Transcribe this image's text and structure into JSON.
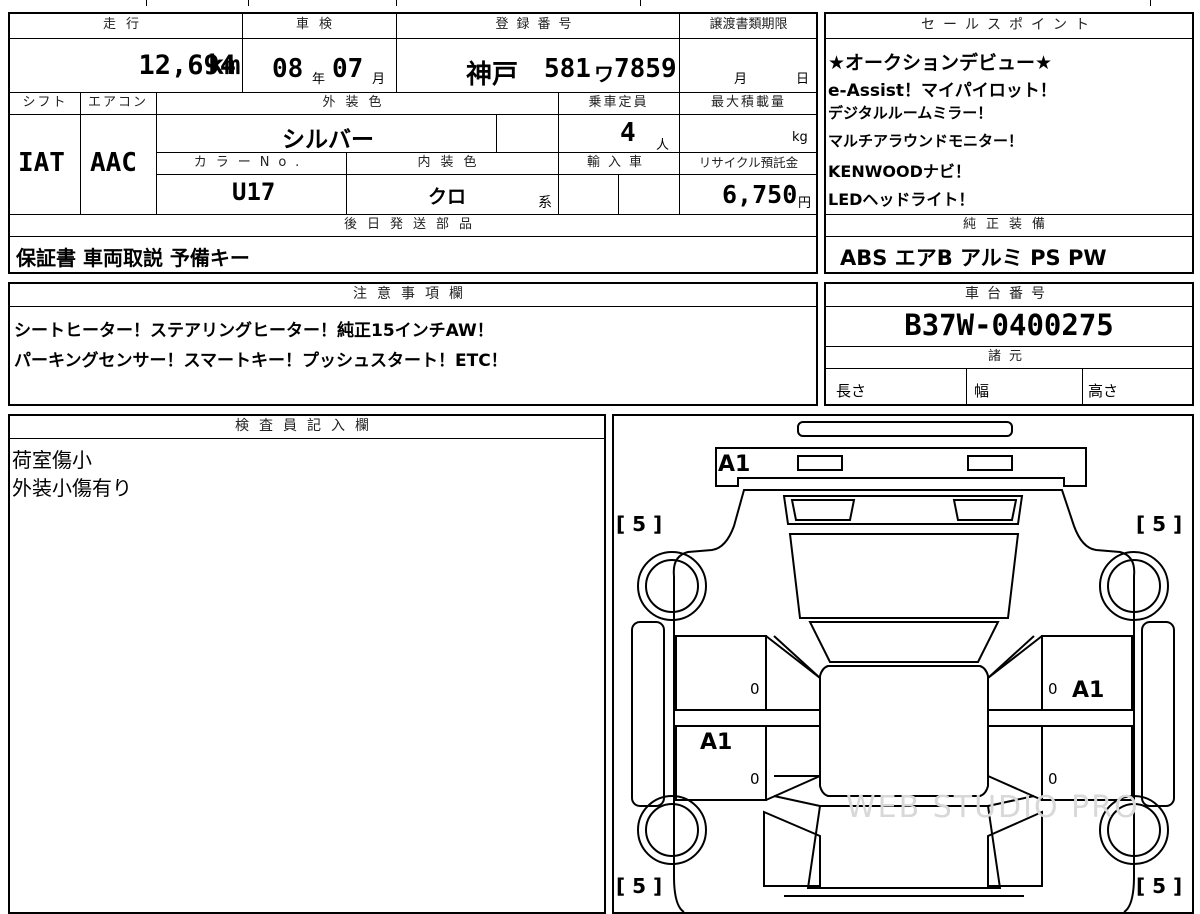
{
  "headers": {
    "mileage": "走行",
    "inspection": "車検",
    "registration": "登録番号",
    "transfer_deadline": "譲渡書類期限",
    "sales_points": "セールスポイント",
    "shift": "シフト",
    "aircon": "エアコン",
    "exterior_color": "外装色",
    "capacity": "乗車定員",
    "max_load": "最大積載量",
    "color_no": "カラーNo.",
    "interior_color": "内装色",
    "import": "輸入車",
    "recycle_fee": "リサイクル預託金",
    "later_parts": "後日発送部品",
    "genuine_equipment": "純正装備",
    "notes": "注意事項欄",
    "chassis_no": "車台番号",
    "specs": "諸元",
    "inspector": "検査員記入欄"
  },
  "vehicle": {
    "mileage_value": "12,694",
    "mileage_unit": "km",
    "inspection_year": "08",
    "year_label": "年",
    "inspection_month": "07",
    "month_label": "月",
    "registration_area": "神戸",
    "registration_class": "581",
    "registration_kana": "ワ",
    "registration_number": "7859",
    "transfer_month_label": "月",
    "transfer_day_label": "日",
    "shift_value": "IAT",
    "aircon_value": "AAC",
    "exterior_color_value": "シルバー",
    "capacity_value": "4",
    "capacity_unit": "人",
    "max_load_unit": "kg",
    "color_no_value": "U17",
    "interior_color_value": "クロ",
    "interior_color_suffix": "系",
    "recycle_value": "6,750",
    "recycle_unit": "円"
  },
  "sales_points": [
    "★オークションデビュー★",
    "e-Assist！マイパイロット！",
    "デジタルルームミラー！",
    "マルチアラウンドモニター！",
    "KENWOODナビ！",
    "LEDヘッドライト！"
  ],
  "later_parts_value": "保証書 車両取説 予備キー",
  "genuine_equipment_value": "ABS エアB アルミ PS PW",
  "notes_lines": [
    "シートヒーター！ステアリングヒーター！純正15インチAW！",
    "パーキングセンサー！スマートキー！プッシュスタート！ETC！"
  ],
  "chassis_no_value": "B37W-0400275",
  "spec_labels": {
    "length": "長さ",
    "width": "幅",
    "height": "高さ"
  },
  "inspector_lines": [
    "荷室傷小",
    "外装小傷有り"
  ],
  "diagram": {
    "marks": {
      "rear": "A1",
      "right_rear_door": "A1",
      "left_front_door": "A1"
    },
    "tires": {
      "fl": "[ 5 ]",
      "fr": "[ 5 ]",
      "rl": "[ 5 ]",
      "rr": "[ 5 ]"
    },
    "door_zeros": {
      "l1": "0",
      "l2": "0",
      "r1": "0",
      "r2": "0"
    },
    "watermark": "WEB STUDIO PRO"
  },
  "colors": {
    "line": "#000000",
    "background": "#ffffff"
  }
}
